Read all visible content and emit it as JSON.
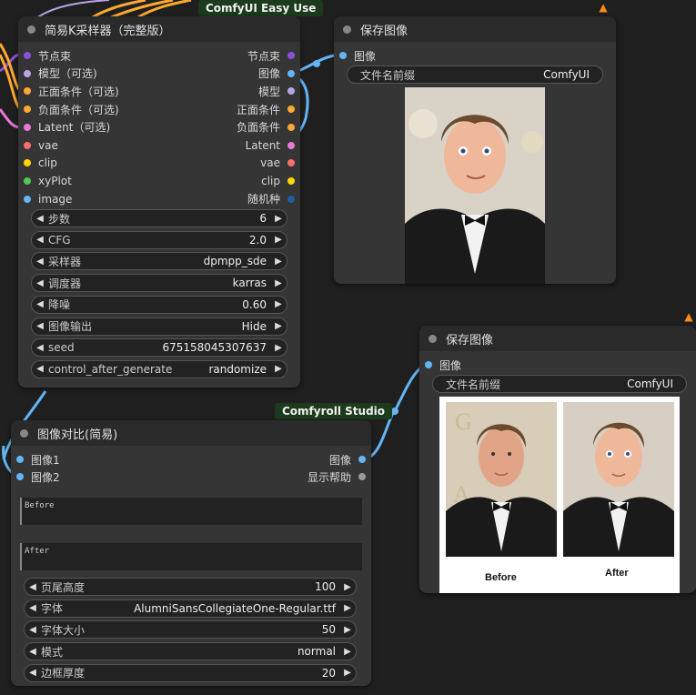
{
  "colors": {
    "canvas": "#1f1f1f",
    "node_body": "#353535",
    "node_title": "#2a2a2a",
    "slot_purple": "#8a4fd8",
    "slot_lilac": "#b9a4e6",
    "slot_orange": "#ffa931",
    "slot_pink": "#e77ad9",
    "slot_red": "#ff6e6e",
    "slot_yellow": "#ffd500",
    "slot_green": "#53c653",
    "slot_blue": "#64b5f6",
    "slot_navy": "#1f5f9f"
  },
  "badges": {
    "easy_use": "ComfyUI Easy Use",
    "comfyroll": "Comfyroll Studio"
  },
  "ksampler": {
    "title": "简易K采样器（完整版）",
    "inputs": [
      "节点束",
      "模型（可选)",
      "正面条件（可选)",
      "负面条件（可选)",
      "Latent（可选)",
      "vae",
      "clip",
      "xyPlot",
      "image"
    ],
    "outputs": [
      "节点束",
      "图像",
      "模型",
      "正面条件",
      "负面条件",
      "Latent",
      "vae",
      "clip",
      "随机种"
    ],
    "widgets": [
      {
        "label": "步数",
        "value": "6"
      },
      {
        "label": "CFG",
        "value": "2.0"
      },
      {
        "label": "采样器",
        "value": "dpmpp_sde"
      },
      {
        "label": "调度器",
        "value": "karras"
      },
      {
        "label": "降噪",
        "value": "0.60"
      },
      {
        "label": "图像输出",
        "value": "Hide"
      },
      {
        "label": "seed",
        "value": "675158045307637"
      },
      {
        "label": "control_after_generate",
        "value": "randomize"
      }
    ]
  },
  "save1": {
    "title": "保存图像",
    "input": "图像",
    "prefix_label": "文件名前缀",
    "prefix_value": "ComfyUI"
  },
  "save2": {
    "title": "保存图像",
    "input": "图像",
    "prefix_label": "文件名前缀",
    "prefix_value": "ComfyUI",
    "before_caption": "Before",
    "after_caption": "After"
  },
  "compare": {
    "title": "图像对比(简易)",
    "inputs": [
      "图像1",
      "图像2"
    ],
    "outputs": [
      "图像",
      "显示帮助"
    ],
    "text1": "Before",
    "text2": "After",
    "widgets": [
      {
        "label": "页尾高度",
        "value": "100"
      },
      {
        "label": "字体",
        "value": "AlumniSansCollegiateOne-Regular.ttf"
      },
      {
        "label": "字体大小",
        "value": "50"
      },
      {
        "label": "模式",
        "value": "normal"
      },
      {
        "label": "边框厚度",
        "value": "20"
      }
    ]
  }
}
